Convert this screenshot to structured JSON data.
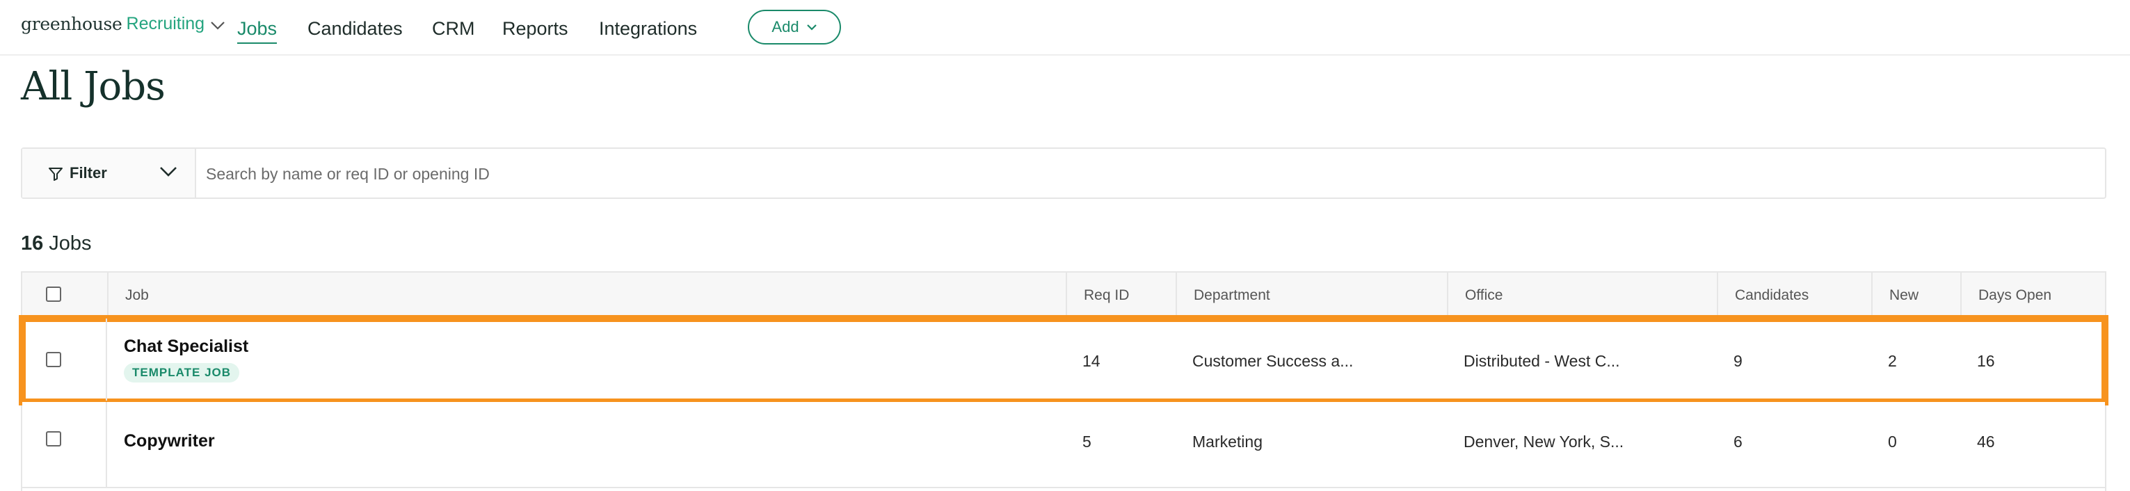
{
  "nav": {
    "brand": "greenhouse",
    "product": "Recruiting",
    "links": [
      {
        "label": "Jobs",
        "active": true
      },
      {
        "label": "Candidates"
      },
      {
        "label": "CRM"
      },
      {
        "label": "Reports"
      },
      {
        "label": "Integrations"
      }
    ],
    "add_label": "Add"
  },
  "page": {
    "title": "All Jobs"
  },
  "filter": {
    "label": "Filter",
    "search_placeholder": "Search by name or req ID or opening ID"
  },
  "jobs_count": {
    "number": "16",
    "label": "Jobs"
  },
  "table": {
    "columns": [
      "Job",
      "Req ID",
      "Department",
      "Office",
      "Candidates",
      "New",
      "Days Open"
    ],
    "rows": [
      {
        "job": "Chat Specialist",
        "badge": "TEMPLATE JOB",
        "req_id": "14",
        "department": "Customer Success a...",
        "office": "Distributed - West C...",
        "candidates": "9",
        "new": "2",
        "days_open": "16",
        "highlighted": true
      },
      {
        "job": "Copywriter",
        "req_id": "5",
        "department": "Marketing",
        "office": "Denver, New York, S...",
        "candidates": "6",
        "new": "0",
        "days_open": "46"
      }
    ]
  },
  "colors": {
    "accent": "#1a8a6a",
    "highlight": "#f7931e",
    "badge_bg": "#e3f5ee"
  },
  "icons": [
    "chevron-down-icon",
    "filter-icon",
    "checkbox-icon"
  ]
}
